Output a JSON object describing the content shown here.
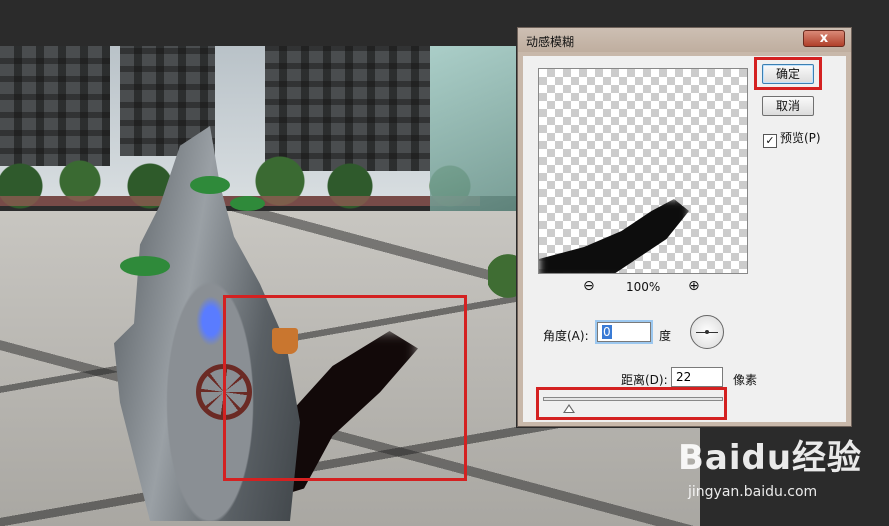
{
  "dialog": {
    "title": "动感模糊",
    "close_label": "x",
    "ok_label": "确定",
    "cancel_label": "取消",
    "preview_label": "预览(P)",
    "preview_checked": true,
    "zoom_out_icon": "zoom-out-icon",
    "zoom_in_icon": "zoom-in-icon",
    "zoom_value": "100%",
    "angle_label": "角度(A):",
    "angle_value": "0",
    "angle_unit": "度",
    "distance_label": "距离(D):",
    "distance_value": "22",
    "distance_unit": "像素"
  },
  "watermark": {
    "brand": "Baidu经验",
    "url": "jingyan.baidu.com"
  },
  "colors": {
    "highlight": "#d42121",
    "dialog_frame": "#c8b8aa",
    "close_button": "#b0402a"
  }
}
